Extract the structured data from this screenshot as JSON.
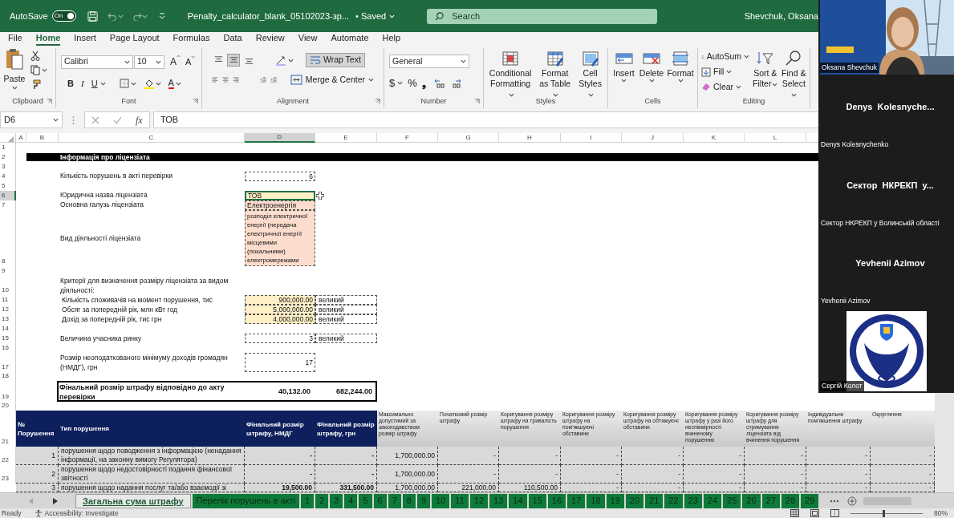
{
  "title_bar": {
    "autosave": "AutoSave",
    "autosave_toggle": {
      "label": "On",
      "on": true
    },
    "file_name": "Penalty_calculator_blank_05102023-зр...",
    "save_status": "• Saved",
    "search": {
      "placeholder": "Search"
    },
    "user": "Shevchuk, Oksana"
  },
  "menu_tabs": [
    {
      "label": "File",
      "selected": false
    },
    {
      "label": "Home",
      "selected": true
    },
    {
      "label": "Insert",
      "selected": false
    },
    {
      "label": "Page Layout",
      "selected": false
    },
    {
      "label": "Formulas",
      "selected": false
    },
    {
      "label": "Data",
      "selected": false
    },
    {
      "label": "Review",
      "selected": false
    },
    {
      "label": "View",
      "selected": false
    },
    {
      "label": "Automate",
      "selected": false
    },
    {
      "label": "Help",
      "selected": false
    }
  ],
  "ribbon": {
    "clipboard": {
      "label": "Clipboard",
      "paste": "Paste"
    },
    "font": {
      "label": "Font",
      "font_name": "Calibri",
      "font_size": "10",
      "grow": "A",
      "shrink": "A",
      "bold": "B",
      "italic": "I",
      "underline": "U",
      "font_color": "A"
    },
    "alignment": {
      "label": "Alignment",
      "vertical_align": [
        {
          "selected": false
        },
        {
          "selected": true
        },
        {
          "selected": false
        }
      ],
      "wrap_text": {
        "label": "Wrap Text",
        "on": true
      },
      "merge": "Merge & Center"
    },
    "number": {
      "label": "Number",
      "format": "General",
      "currency": "$",
      "percent": "%",
      "comma": "❟"
    },
    "styles": {
      "label": "Styles",
      "buttons": [
        "Conditional Formatting",
        "Format as Table",
        "Cell Styles"
      ]
    },
    "cells": {
      "label": "Cells",
      "buttons": [
        "Insert",
        "Delete",
        "Format"
      ]
    },
    "editing": {
      "label": "Editing",
      "small_buttons": [
        "AutoSum",
        "Fill",
        "Clear"
      ],
      "buttons": [
        "Sort & Filter",
        "Find & Select"
      ]
    }
  },
  "formula_bar": {
    "name_box": "D6",
    "fx": "fx",
    "value": "ТОВ"
  },
  "sheet": {
    "columns": [
      {
        "letter": "A",
        "selected": false
      },
      {
        "letter": "B",
        "selected": false
      },
      {
        "letter": "C",
        "selected": false
      },
      {
        "letter": "D",
        "selected": true
      },
      {
        "letter": "E",
        "selected": false
      },
      {
        "letter": "F",
        "selected": false
      },
      {
        "letter": "G",
        "selected": false
      },
      {
        "letter": "H",
        "selected": false
      },
      {
        "letter": "I",
        "selected": false
      },
      {
        "letter": "J",
        "selected": false
      },
      {
        "letter": "K",
        "selected": false
      },
      {
        "letter": "L",
        "selected": false
      }
    ],
    "rows": [
      {
        "number": "1",
        "selected": false
      },
      {
        "number": "2",
        "selected": false
      },
      {
        "number": "3",
        "selected": false
      },
      {
        "number": "4",
        "selected": false
      },
      {
        "number": "5",
        "selected": false
      },
      {
        "number": "6",
        "selected": true
      },
      {
        "number": "7",
        "selected": false
      },
      {
        "number": "8",
        "selected": false
      },
      {
        "number": "9",
        "selected": false
      },
      {
        "number": "10",
        "selected": false
      },
      {
        "number": "11",
        "selected": false
      },
      {
        "number": "12",
        "selected": false
      },
      {
        "number": "13",
        "selected": false
      },
      {
        "number": "14",
        "selected": false
      },
      {
        "number": "15",
        "selected": false
      },
      {
        "number": "16",
        "selected": false
      },
      {
        "number": "17",
        "selected": false
      },
      {
        "number": "18",
        "selected": false
      },
      {
        "number": "19",
        "selected": false
      },
      {
        "number": "20",
        "selected": false
      },
      {
        "number": "21",
        "selected": false
      },
      {
        "number": "22",
        "selected": false
      },
      {
        "number": "23",
        "selected": false
      }
    ]
  },
  "license_info": {
    "title": "Інформація про ліцензіата",
    "fields": [
      {
        "label": "Кількість порушень в акті перевірки",
        "value": "6",
        "kind": "plain",
        "selected": false
      },
      {
        "label": "Юридична назва ліцензіата",
        "value": "ТОВ",
        "kind": "input",
        "selected": true
      },
      {
        "label": "Основна галузь ліцензіата",
        "value": "Електроенергія",
        "kind": "lookup",
        "selected": false
      },
      {
        "label": "Вид діяльності ліцензіата",
        "value": "розподіл електричної енергії (передача електричної енергії місцевими (локальними) електромережами",
        "kind": "lookup",
        "selected": false
      }
    ]
  },
  "criteria": {
    "title": "Критерії для визначення розміру ліцензіата за видом діяльності:",
    "items": [
      {
        "label": "Кількість споживачів на момент порушення, тис",
        "value": "900,000.00",
        "size": "великий"
      },
      {
        "label": "Обсяг за попередній рік, млн кВт год",
        "value": "5,000,000.00",
        "size": "великий"
      },
      {
        "label": "Дохід за попередній рік, тис грн",
        "value": "4,000,000.00",
        "size": "великий"
      }
    ]
  },
  "market_participant": {
    "label": "Величина учасника ринку",
    "value": "3",
    "size": "великий"
  },
  "nmdg": {
    "label": "Розмір неоподаткованого мінімуму доходів громадян (НМДГ), грн",
    "value": "17"
  },
  "final_fine": {
    "label": "Фінальний розмір штрафу відповідно до акту перевірки",
    "nmdg": "40,132.00",
    "uah": "682,244.00"
  },
  "violations": {
    "columns": [
      {
        "label": "№ Порушення",
        "kind": "primary"
      },
      {
        "label": "Тип порушення",
        "kind": "primary"
      },
      {
        "label": "Фінальний розмір штрафу, НМДГ",
        "kind": "primary"
      },
      {
        "label": "Фінальний розмір штрафу, грн",
        "kind": "primary"
      },
      {
        "label": "Максимально допустимий за законодавством розмір штрафу",
        "kind": "secondary"
      },
      {
        "label": "Початковий розмір штрафу",
        "kind": "secondary"
      },
      {
        "label": "Коригування розміру штрафу на тривалість порушення",
        "kind": "secondary"
      },
      {
        "label": "Коригування розміру штрафу на пом'якшуючі обставини",
        "kind": "secondary"
      },
      {
        "label": "Коригування розміру штрафу на обтяжуючі обставини",
        "kind": "secondary"
      },
      {
        "label": "Коригування розміру штрафу у разі його неспівмірності вчиненому порушенню",
        "kind": "secondary"
      },
      {
        "label": "Коригування розміру штрафу для стримування ліцензіата від вчинення  порушення",
        "kind": "secondary"
      },
      {
        "label": "Індивідуальне пом'якшення штрафу",
        "kind": "secondary"
      },
      {
        "label": "Округлення",
        "kind": "secondary"
      }
    ],
    "rows": [
      {
        "cells": [
          "1",
          "порушення щодо поводження з інформацією (ненадання інформації, на законну вимогу Регулятора)",
          "-",
          "-",
          "1,700,000.00",
          "-",
          "-",
          "-",
          "-",
          "-",
          "-",
          "-",
          "-"
        ]
      },
      {
        "cells": [
          "2",
          "порушення щодо недостовірності подання фінансової звітності",
          "-",
          "-",
          "1,700,000.00",
          "-",
          "-",
          "-",
          "-",
          "-",
          "-",
          "-",
          "-"
        ]
      },
      {
        "cells": [
          "3",
          "порушення щодо надання послуг та/або взаємодії зі",
          "19,500.00",
          "331,500.00",
          "1,700,000.00",
          "221,000.00",
          "110,500.00",
          "-",
          "-",
          "-",
          "-",
          "-",
          "-"
        ]
      }
    ]
  },
  "sheet_tabs": [
    {
      "label": "Загальна сума штрафу",
      "selected": true
    },
    {
      "label": "Перелік порушень в акті",
      "selected": false
    },
    {
      "label": "1",
      "selected": false
    },
    {
      "label": "2",
      "selected": false
    },
    {
      "label": "3",
      "selected": false
    },
    {
      "label": "4",
      "selected": false
    },
    {
      "label": "5",
      "selected": false
    },
    {
      "label": "6",
      "selected": false
    },
    {
      "label": "7",
      "selected": false
    },
    {
      "label": "8",
      "selected": false
    },
    {
      "label": "9",
      "selected": false
    },
    {
      "label": "10",
      "selected": false
    },
    {
      "label": "11",
      "selected": false
    },
    {
      "label": "12",
      "selected": false
    },
    {
      "label": "13",
      "selected": false
    },
    {
      "label": "14",
      "selected": false
    },
    {
      "label": "15",
      "selected": false
    },
    {
      "label": "16",
      "selected": false
    },
    {
      "label": "17",
      "selected": false
    },
    {
      "label": "18",
      "selected": false
    },
    {
      "label": "19",
      "selected": false
    },
    {
      "label": "20",
      "selected": false
    },
    {
      "label": "21",
      "selected": false
    },
    {
      "label": "22",
      "selected": false
    },
    {
      "label": "23",
      "selected": false
    },
    {
      "label": "24",
      "selected": false
    },
    {
      "label": "25",
      "selected": false
    },
    {
      "label": "26",
      "selected": false
    },
    {
      "label": "27",
      "selected": false
    },
    {
      "label": "28",
      "selected": false
    },
    {
      "label": "29",
      "selected": false
    }
  ],
  "status_bar": {
    "status": "Ready",
    "accessibility": "Accessibility: Investigate",
    "zoom_slider": {
      "level": 0.45
    },
    "zoom": "80%"
  },
  "call_panel": {
    "participants": [
      {
        "kind": "video",
        "name": "Oksana Shevchuk"
      },
      {
        "kind": "avatar",
        "title": "Denys  Kolesnyche...",
        "name": "Denys Kolesnychenko"
      },
      {
        "kind": "avatar",
        "title": "Сектор  НКРЕКП  у...",
        "name": "Сектор НКРЕКП у Волинській області"
      },
      {
        "kind": "avatar",
        "title": "Yevhenii Azimov",
        "name": "Yevhenii Azimov"
      },
      {
        "kind": "video",
        "name": "Сергій Колот"
      }
    ]
  }
}
